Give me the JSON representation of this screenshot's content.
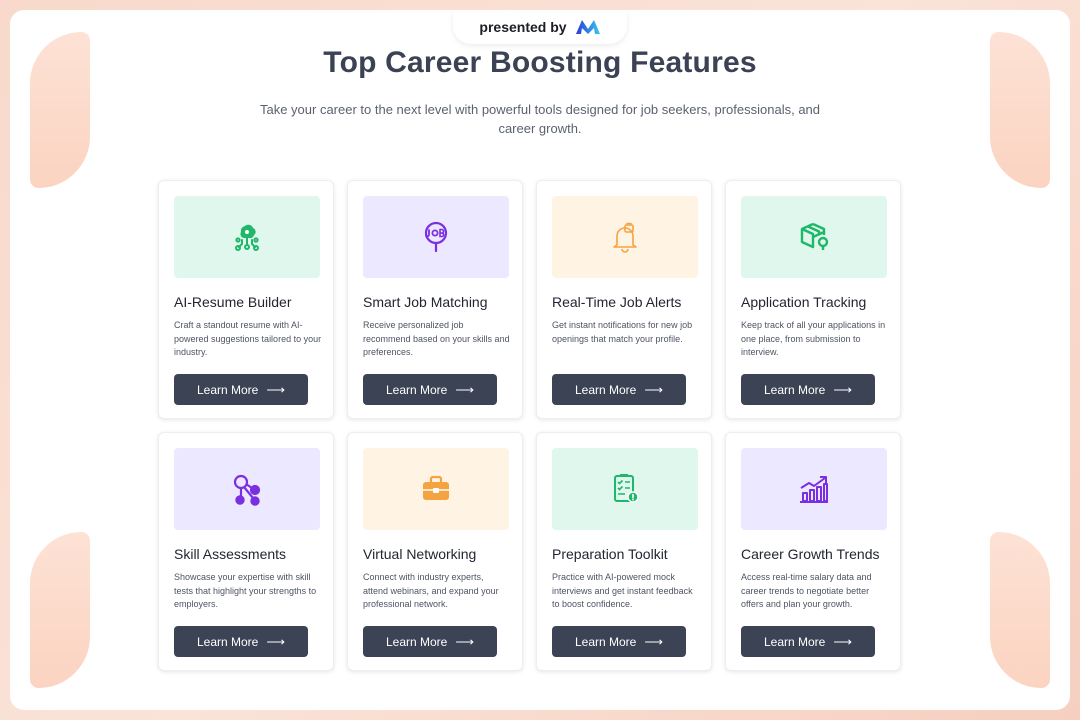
{
  "header": {
    "presented_label": "presented by",
    "title": "Top Career Boosting Features",
    "subtitle": "Take your career to the next level with powerful tools designed for job seekers, professionals, and career growth."
  },
  "colors": {
    "button": "#3b4354",
    "green_bg": "#dff7ec",
    "purple_bg": "#ece8ff",
    "orange_bg": "#fff3e4",
    "green_icon": "#1fb76a",
    "purple_icon": "#7a2fe0",
    "orange_icon": "#f5a340"
  },
  "cards": [
    {
      "title": "AI-Resume Builder",
      "desc": "Craft a standout resume with AI-powered suggestions tailored to your industry.",
      "button": "Learn More",
      "arrow": "⟶",
      "icon": "ai-brain-icon",
      "theme": "green"
    },
    {
      "title": "Smart Job Matching",
      "desc": "Receive personalized job recommend based on your skills and preferences.",
      "button": "Learn More",
      "arrow": "⟶",
      "icon": "job-search-icon",
      "theme": "purple"
    },
    {
      "title": "Real-Time Job Alerts",
      "desc": "Get instant notifications for new job openings that match your profile.",
      "button": "Learn More",
      "arrow": "⟶",
      "icon": "bell-icon",
      "theme": "orange"
    },
    {
      "title": "Application Tracking",
      "desc": "Keep track of all your applications in one place, from submission to interview.",
      "button": "Learn More",
      "arrow": "⟶",
      "icon": "package-tracking-icon",
      "theme": "green"
    },
    {
      "title": "Skill Assessments",
      "desc": "Showcase your expertise with skill tests that highlight your strengths to employers.",
      "button": "Learn More",
      "arrow": "⟶",
      "icon": "network-nodes-icon",
      "theme": "purple"
    },
    {
      "title": "Virtual Networking",
      "desc": "Connect with industry experts, attend webinars, and expand your professional network.",
      "button": "Learn More",
      "arrow": "⟶",
      "icon": "briefcase-icon",
      "theme": "orange"
    },
    {
      "title": "Preparation Toolkit",
      "desc": "Practice with AI-powered mock interviews and get instant feedback to boost confidence.",
      "button": "Learn More",
      "arrow": "⟶",
      "icon": "checklist-icon",
      "theme": "green"
    },
    {
      "title": "Career Growth Trends",
      "desc": "Access real-time salary data and career trends to negotiate better offers and plan your growth.",
      "button": "Learn More",
      "arrow": "⟶",
      "icon": "growth-chart-icon",
      "theme": "purple"
    }
  ]
}
